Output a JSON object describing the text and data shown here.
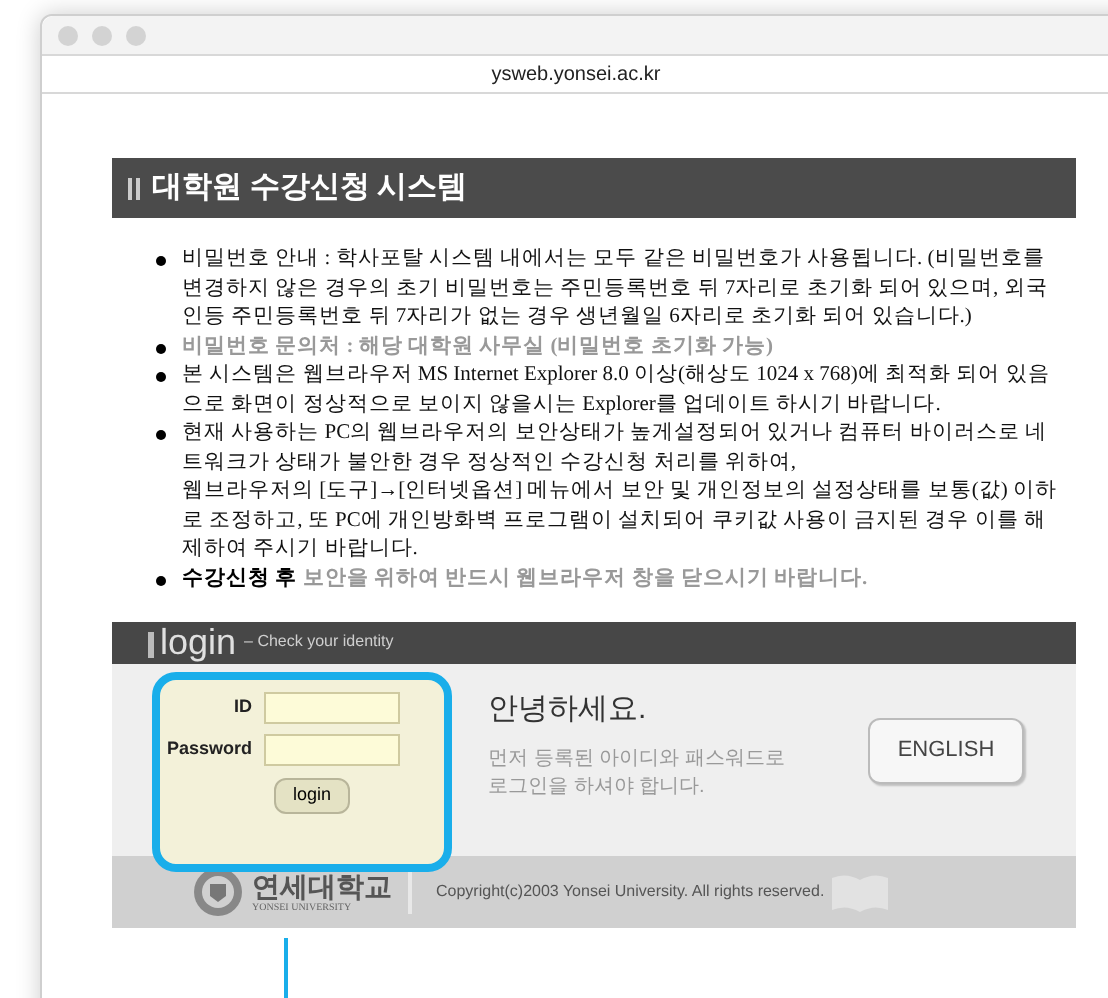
{
  "window": {
    "url": "ysweb.yonsei.ac.kr"
  },
  "page_title": "대학원 수강신청 시스템",
  "notices": [
    {
      "text": "비밀번호 안내 : 학사포탈 시스템 내에서는 모두 같은 비밀번호가 사용됩니다. (비밀번호를 변경하지 않은 경우의 초기 비밀번호는 주민등록번호 뒤 7자리로 초기화 되어 있으며, 외국인등 주민등록번호 뒤 7자리가 없는 경우 생년월일 6자리로 초기화 되어 있습니다.)",
      "muted": false
    },
    {
      "text": "비밀번호 문의처 : 해당 대학원 사무실 (비밀번호 초기화 가능)",
      "muted": true
    },
    {
      "text": "본 시스템은 웹브라우저 MS Internet Explorer 8.0 이상(해상도 1024 x 768)에 최적화 되어 있음으로 화면이 정상적으로 보이지 않을시는 Explorer를 업데이트 하시기 바랍니다.",
      "muted": false
    },
    {
      "text": "현재 사용하는 PC의 웹브라우저의 보안상태가 높게설정되어 있거나 컴퓨터 바이러스로 네트워크가 상태가 불안한 경우 정상적인 수강신청 처리를 위하여,\n웹브라우저의 [도구]→[인터넷옵션] 메뉴에서 보안 및 개인정보의 설정상태를 보통(값) 이하로 조정하고, 또 PC에 개인방화벽 프로그램이 설치되어 쿠키값 사용이 금지된 경우 이를 해제하여 주시기 바랍니다.",
      "muted": false
    },
    {
      "text": "**수강신청 후** 보안을 위하여 반드시 웹브라우저 창을 닫으시기 바랍니다.",
      "muted": true
    }
  ],
  "login": {
    "heading": "login",
    "subheading": "– Check your identity",
    "fields": [
      {
        "label": "ID"
      },
      {
        "label": "Password"
      }
    ],
    "submit": "login",
    "greeting": "안녕하세요.",
    "instruction": "먼저 등록된 아이디와 패스워드로\n로그인을 하셔야 합니다.",
    "language_button": "ENGLISH"
  },
  "footer": {
    "university_name": "연세대학교",
    "university_name_en": "YONSEI UNIVERSITY",
    "copyright": "Copyright(c)2003 Yonsei University. All rights reserved."
  }
}
